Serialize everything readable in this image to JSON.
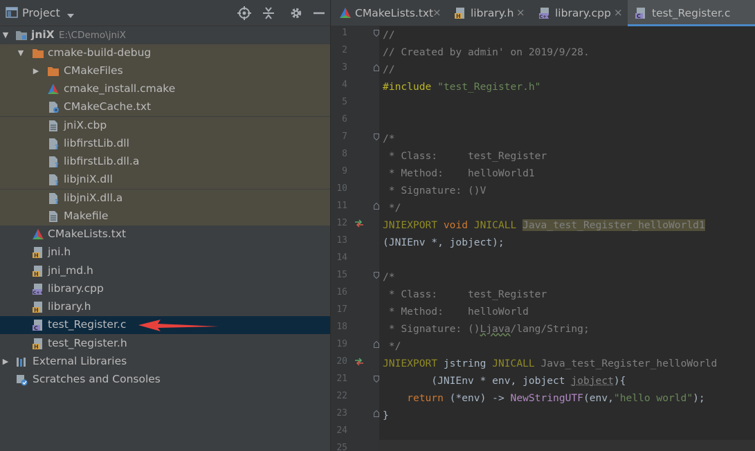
{
  "project_panel": {
    "title": "Project",
    "icons": [
      "locate-icon",
      "collapse-icon",
      "settings-icon",
      "hide-icon"
    ],
    "tree": [
      {
        "label": "jniX",
        "path": "E:\\CDemo\\jniX",
        "icon": "folder-module-icon",
        "expanded": true
      },
      {
        "label": "cmake-build-debug",
        "icon": "folder-excluded-icon",
        "expanded": true
      },
      {
        "label": "CMakeFiles",
        "icon": "folder-excluded-icon",
        "expanded": false
      },
      {
        "label": "cmake_install.cmake",
        "icon": "cmake-icon"
      },
      {
        "label": "CMakeCache.txt",
        "icon": "text-file-gear-icon"
      },
      {
        "label": "jniX.cbp",
        "icon": "text-file-icon"
      },
      {
        "label": "libfirstLib.dll",
        "icon": "unknown-file-icon"
      },
      {
        "label": "libfirstLib.dll.a",
        "icon": "unknown-file-icon"
      },
      {
        "label": "libjniX.dll",
        "icon": "unknown-file-icon"
      },
      {
        "label": "libjniX.dll.a",
        "icon": "unknown-file-icon"
      },
      {
        "label": "Makefile",
        "icon": "text-file-icon"
      },
      {
        "label": "CMakeLists.txt",
        "icon": "cmake-icon"
      },
      {
        "label": "jni.h",
        "icon": "h-file-icon"
      },
      {
        "label": "jni_md.h",
        "icon": "h-file-icon"
      },
      {
        "label": "library.cpp",
        "icon": "cpp-file-icon"
      },
      {
        "label": "library.h",
        "icon": "h-file-icon"
      },
      {
        "label": "test_Register.c",
        "icon": "c-file-icon",
        "selected": true
      },
      {
        "label": "test_Register.h",
        "icon": "h-file-icon"
      },
      {
        "label": "External Libraries",
        "icon": "libraries-icon",
        "expanded": false
      },
      {
        "label": "Scratches and Consoles",
        "icon": "scratches-icon"
      }
    ],
    "annotation_arrow_color": "#e8413c"
  },
  "editor": {
    "tabs": [
      {
        "label": "CMakeLists.txt",
        "icon": "cmake-icon",
        "active": false
      },
      {
        "label": "library.h",
        "icon": "h-file-icon",
        "active": false
      },
      {
        "label": "library.cpp",
        "icon": "cpp-file-icon",
        "active": false
      },
      {
        "label": "test_Register.c",
        "icon": "c-file-icon",
        "active": true
      }
    ],
    "close_glyph": "×",
    "line_numbers": [
      "1",
      "2",
      "3",
      "4",
      "5",
      "6",
      "7",
      "8",
      "9",
      "10",
      "11",
      "12",
      "13",
      "14",
      "15",
      "16",
      "17",
      "18",
      "19",
      "20",
      "21",
      "22",
      "23",
      "24",
      "25"
    ],
    "code": {
      "l1": "//",
      "l2": "// Created by admin' on 2019/9/28.",
      "l3": "//",
      "l4_directive": "#include",
      "l4_string": "\"test_Register.h\"",
      "l7": "/*",
      "l8": " * Class:     test_Register",
      "l9": " * Method:    helloWorld1",
      "l10": " * Signature: ()V",
      "l11": " */",
      "l12_kw1": "JNIEXPORT",
      "l12_kw2": "void",
      "l12_kw3": "JNICALL",
      "l12_fn": "Java_test_Register_helloWorld1",
      "l13": "(JNIEnv *, jobject);",
      "l15": "/*",
      "l16": " * Class:     test_Register",
      "l17": " * Method:    helloWorld",
      "l18_a": " * Signature: ()",
      "l18_b": "Ljava",
      "l18_c": "/lang/String;",
      "l19": " */",
      "l20_kw1": "JNIEXPORT",
      "l20_type": "jstring",
      "l20_kw3": "JNICALL",
      "l20_fn": "Java_test_Register_helloWorld",
      "l21_a": "        (JNIEnv * env, jobject ",
      "l21_b": "jobject",
      "l21_c": "){",
      "l22_kw": "return",
      "l22_a": " (*env) -> ",
      "l22_call": "NewStringUTF",
      "l22_b": "(env,",
      "l22_str": "\"hello world\"",
      "l22_c": ");",
      "l23": "}"
    }
  }
}
